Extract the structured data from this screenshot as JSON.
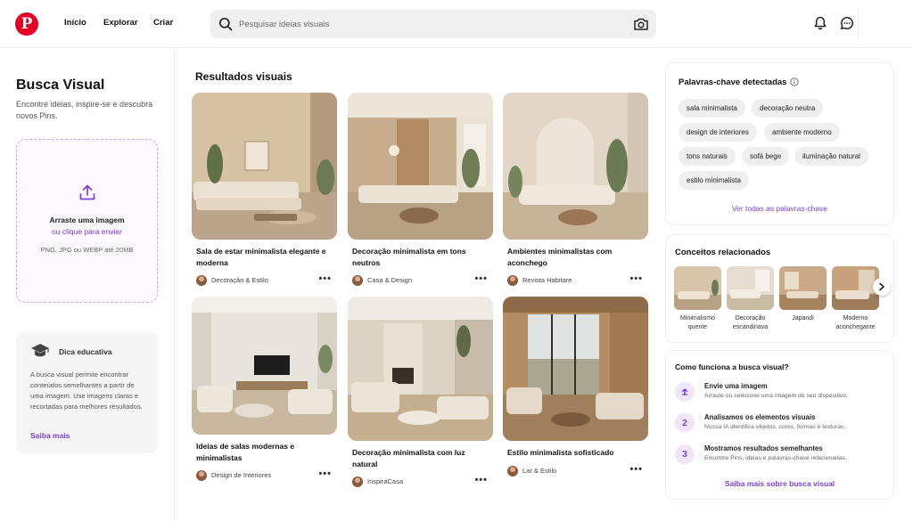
{
  "header": {
    "logo_letter": "P",
    "nav": [
      "Início",
      "Explorar",
      "Criar"
    ],
    "search_placeholder": "Pesquisar ideias visuais",
    "icons": [
      "search-icon",
      "camera-icon",
      "bell-icon",
      "chat-icon"
    ]
  },
  "left_panel": {
    "title": "Busca Visual",
    "subtitle": "Encontre ideias, inspire-se e descubra novos Pins.",
    "upload": {
      "title": "Arraste uma imagem",
      "link": "ou clique para enviar",
      "formats": "PNG, JPG ou WEBP até 20MB"
    },
    "tip": {
      "title": "Dica educativa",
      "body": "A busca visual permite encontrar conteúdos semelhantes a partir de uma imagem. Use imagens claras e recortadas para melhores resultados.",
      "link": "Saiba mais"
    }
  },
  "results": {
    "title": "Resultados visuais",
    "cards": [
      {
        "title": "Sala de estar minimalista elegante e moderna",
        "source": "Decoração & Estilo"
      },
      {
        "title": "Decoração minimalista em tons neutros",
        "source": "Casa & Design"
      },
      {
        "title": "Ambientes minimalistas com aconchego",
        "source": "Revista Habitare"
      },
      {
        "title": "Ideias de salas modernas e minimalistas",
        "source": "Design de Interiores"
      },
      {
        "title": "Decoração minimalista com luz natural",
        "source": "InspiraCasa"
      },
      {
        "title": "Estilo minimalista sofisticado",
        "source": "Lar & Estilo"
      }
    ],
    "more_label": "•••"
  },
  "keywords": {
    "title": "Palavras-chave detectadas",
    "chips": [
      "sala minimalista",
      "decoração neutra",
      "design de interiores",
      "ambiente moderno",
      "tons naturais",
      "sofá bege",
      "iluminação natural",
      "estilo minimalista"
    ],
    "more": "Ver todas as palavras-chave"
  },
  "related": {
    "title": "Conceitos relacionados",
    "items": [
      "Minimalismo quente",
      "Decoração escandinava",
      "Japandi",
      "Moderno aconchegante"
    ]
  },
  "how": {
    "title": "Como funciona a busca visual?",
    "steps": [
      {
        "num": "1",
        "title": "Envie uma imagem",
        "desc": "Arraste ou selecione uma imagem do seu dispositivo."
      },
      {
        "num": "2",
        "title": "Analisamos os elementos visuais",
        "desc": "Nossa IA identifica objetos, cores, formas e texturas."
      },
      {
        "num": "3",
        "title": "Mostramos resultados semelhantes",
        "desc": "Encontre Pins, ideias e palavras-chave relacionadas."
      }
    ],
    "link": "Saiba mais sobre busca visual"
  },
  "colors": {
    "brand": "#e60023",
    "accent": "#7b3fe4",
    "chip_bg": "#efefef"
  }
}
